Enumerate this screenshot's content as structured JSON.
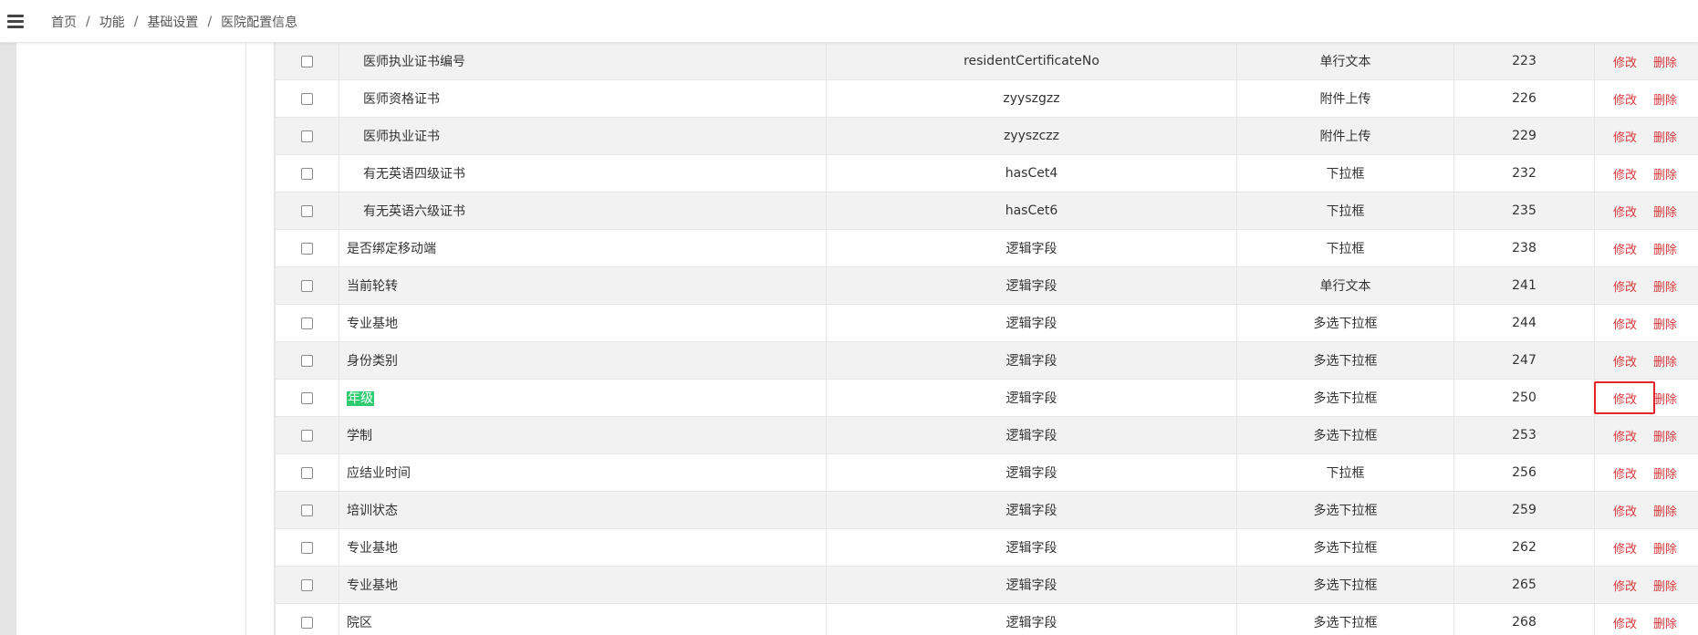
{
  "breadcrumb": {
    "items": [
      "首页",
      "功能",
      "基础设置",
      "医院配置信息"
    ],
    "separator": "/"
  },
  "colors": {
    "delete_link": "#d9383a",
    "edit_link": "#d9383a",
    "highlight_bg": "#2ecc71",
    "focus_box": "#e0242a"
  },
  "table": {
    "rows": [
      {
        "name": "医师执业证书编号",
        "code": "residentCertificateNo",
        "type": "单行文本",
        "sort": "223",
        "edit": "修改",
        "delete": "删除"
      },
      {
        "name": "医师资格证书",
        "code": "zyyszgzz",
        "type": "附件上传",
        "sort": "226",
        "edit": "修改",
        "delete": "删除"
      },
      {
        "name": "医师执业证书",
        "code": "zyyszczz",
        "type": "附件上传",
        "sort": "229",
        "edit": "修改",
        "delete": "删除"
      },
      {
        "name": "有无英语四级证书",
        "code": "hasCet4",
        "type": "下拉框",
        "sort": "232",
        "edit": "修改",
        "delete": "删除"
      },
      {
        "name": "有无英语六级证书",
        "code": "hasCet6",
        "type": "下拉框",
        "sort": "235",
        "edit": "修改",
        "delete": "删除"
      },
      {
        "name": "是否绑定移动端",
        "code": "逻辑字段",
        "type": "下拉框",
        "sort": "238",
        "edit": "修改",
        "delete": "删除"
      },
      {
        "name": "当前轮转",
        "code": "逻辑字段",
        "type": "单行文本",
        "sort": "241",
        "edit": "修改",
        "delete": "删除"
      },
      {
        "name": "专业基地",
        "code": "逻辑字段",
        "type": "多选下拉框",
        "sort": "244",
        "edit": "修改",
        "delete": "删除"
      },
      {
        "name": "身份类别",
        "code": "逻辑字段",
        "type": "多选下拉框",
        "sort": "247",
        "edit": "修改",
        "delete": "删除"
      },
      {
        "name": "年级",
        "code": "逻辑字段",
        "type": "多选下拉框",
        "sort": "250",
        "edit": "修改",
        "delete": "删除"
      },
      {
        "name": "学制",
        "code": "逻辑字段",
        "type": "多选下拉框",
        "sort": "253",
        "edit": "修改",
        "delete": "删除"
      },
      {
        "name": "应结业时间",
        "code": "逻辑字段",
        "type": "下拉框",
        "sort": "256",
        "edit": "修改",
        "delete": "删除"
      },
      {
        "name": "培训状态",
        "code": "逻辑字段",
        "type": "多选下拉框",
        "sort": "259",
        "edit": "修改",
        "delete": "删除"
      },
      {
        "name": "专业基地",
        "code": "逻辑字段",
        "type": "多选下拉框",
        "sort": "262",
        "edit": "修改",
        "delete": "删除"
      },
      {
        "name": "专业基地",
        "code": "逻辑字段",
        "type": "多选下拉框",
        "sort": "265",
        "edit": "修改",
        "delete": "删除"
      },
      {
        "name": "院区",
        "code": "逻辑字段",
        "type": "多选下拉框",
        "sort": "268",
        "edit": "修改",
        "delete": "删除"
      }
    ]
  }
}
